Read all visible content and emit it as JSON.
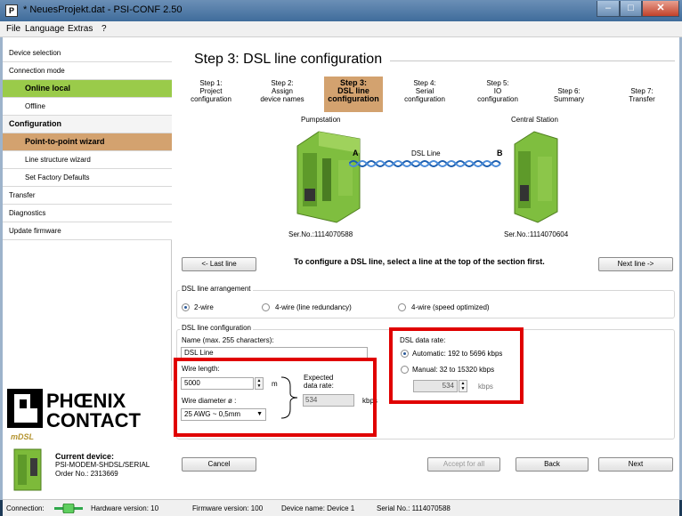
{
  "window": {
    "title": "* NeuesProjekt.dat - PSI-CONF 2.50",
    "icon": "app-icon",
    "controls": [
      "minimize-icon",
      "maximize-icon",
      "close-icon"
    ]
  },
  "menu": {
    "file": "File",
    "language": "Language",
    "extras": "Extras",
    "help": "?"
  },
  "sidebar": {
    "device_selection": "Device selection",
    "connection_mode": "Connection mode",
    "online_local": "Online local",
    "offline": "Offline",
    "configuration": "Configuration",
    "p2p_wizard": "Point-to-point wizard",
    "line_structure_wizard": "Line structure wizard",
    "set_factory_defaults": "Set Factory Defaults",
    "transfer": "Transfer",
    "diagnostics": "Diagnostics",
    "update_firmware": "Update firmware",
    "current_device_title": "Current device:",
    "current_device_name": "PSI-MODEM-SHDSL/SERIAL",
    "current_device_order": "Order No.: 2313669",
    "mdsl_label": "mDSL"
  },
  "page": {
    "title": "Step 3: DSL line configuration",
    "steps": [
      {
        "l1": "Step 1:",
        "l2": "Project",
        "l3": "configuration"
      },
      {
        "l1": "Step 2:",
        "l2": "Assign",
        "l3": "device names"
      },
      {
        "l1": "Step 3:",
        "l2": "DSL line",
        "l3": "configuration"
      },
      {
        "l1": "Step 4:",
        "l2": "Serial",
        "l3": "configuration"
      },
      {
        "l1": "Step 5:",
        "l2": "IO",
        "l3": "configuration"
      },
      {
        "l1": "Step 6:",
        "l2": "Summary",
        "l3": ""
      },
      {
        "l1": "Step 7:",
        "l2": "Transfer",
        "l3": ""
      }
    ]
  },
  "diagram": {
    "left_station": "Pumpstation",
    "right_station": "Central Station",
    "left_letter": "A",
    "right_letter": "B",
    "line_label": "DSL Line",
    "left_serial": "Ser.No.:1114070588",
    "right_serial": "Ser.No.:1114070604"
  },
  "nav": {
    "last_line": "<- Last line",
    "next_line": "Next line ->",
    "instruction": "To configure a DSL line, select a line at the top of the section first."
  },
  "arrangement": {
    "legend": "DSL line arrangement",
    "opt_2wire": "2-wire",
    "opt_4wire_redundancy": "4-wire (line redundancy)",
    "opt_4wire_speed": "4-wire (speed optimized)",
    "selected": "2-wire"
  },
  "line_config": {
    "legend": "DSL line configuration",
    "name_label": "Name (max. 255 characters):",
    "name_value": "DSL Line",
    "wire_length_label": "Wire length:",
    "wire_length_value": "5000",
    "wire_length_unit": "m",
    "wire_diameter_label": "Wire diameter ø :",
    "wire_diameter_value": "25 AWG ~ 0,5mm",
    "expected_rate_label_1": "Expected",
    "expected_rate_label_2": "data rate:",
    "expected_rate_value": "534",
    "expected_rate_unit": "kbps"
  },
  "data_rate": {
    "legend": "DSL data rate:",
    "automatic": "Automatic: 192 to 5696 kbps",
    "manual": "Manual: 32 to 15320 kbps",
    "manual_value": "534",
    "manual_unit": "kbps",
    "selected": "automatic"
  },
  "footer_buttons": {
    "cancel": "Cancel",
    "accept_all": "Accept for all",
    "back": "Back",
    "next": "Next"
  },
  "status": {
    "connection_label": "Connection:",
    "hardware": "Hardware version: 10",
    "firmware": "Firmware version: 100",
    "device_name": "Device name: Device 1",
    "serial": "Serial No.: 1114070588"
  },
  "colors": {
    "accent_orange": "#d3a26f",
    "accent_green": "#9acb4a",
    "highlight_red": "#e00000"
  }
}
